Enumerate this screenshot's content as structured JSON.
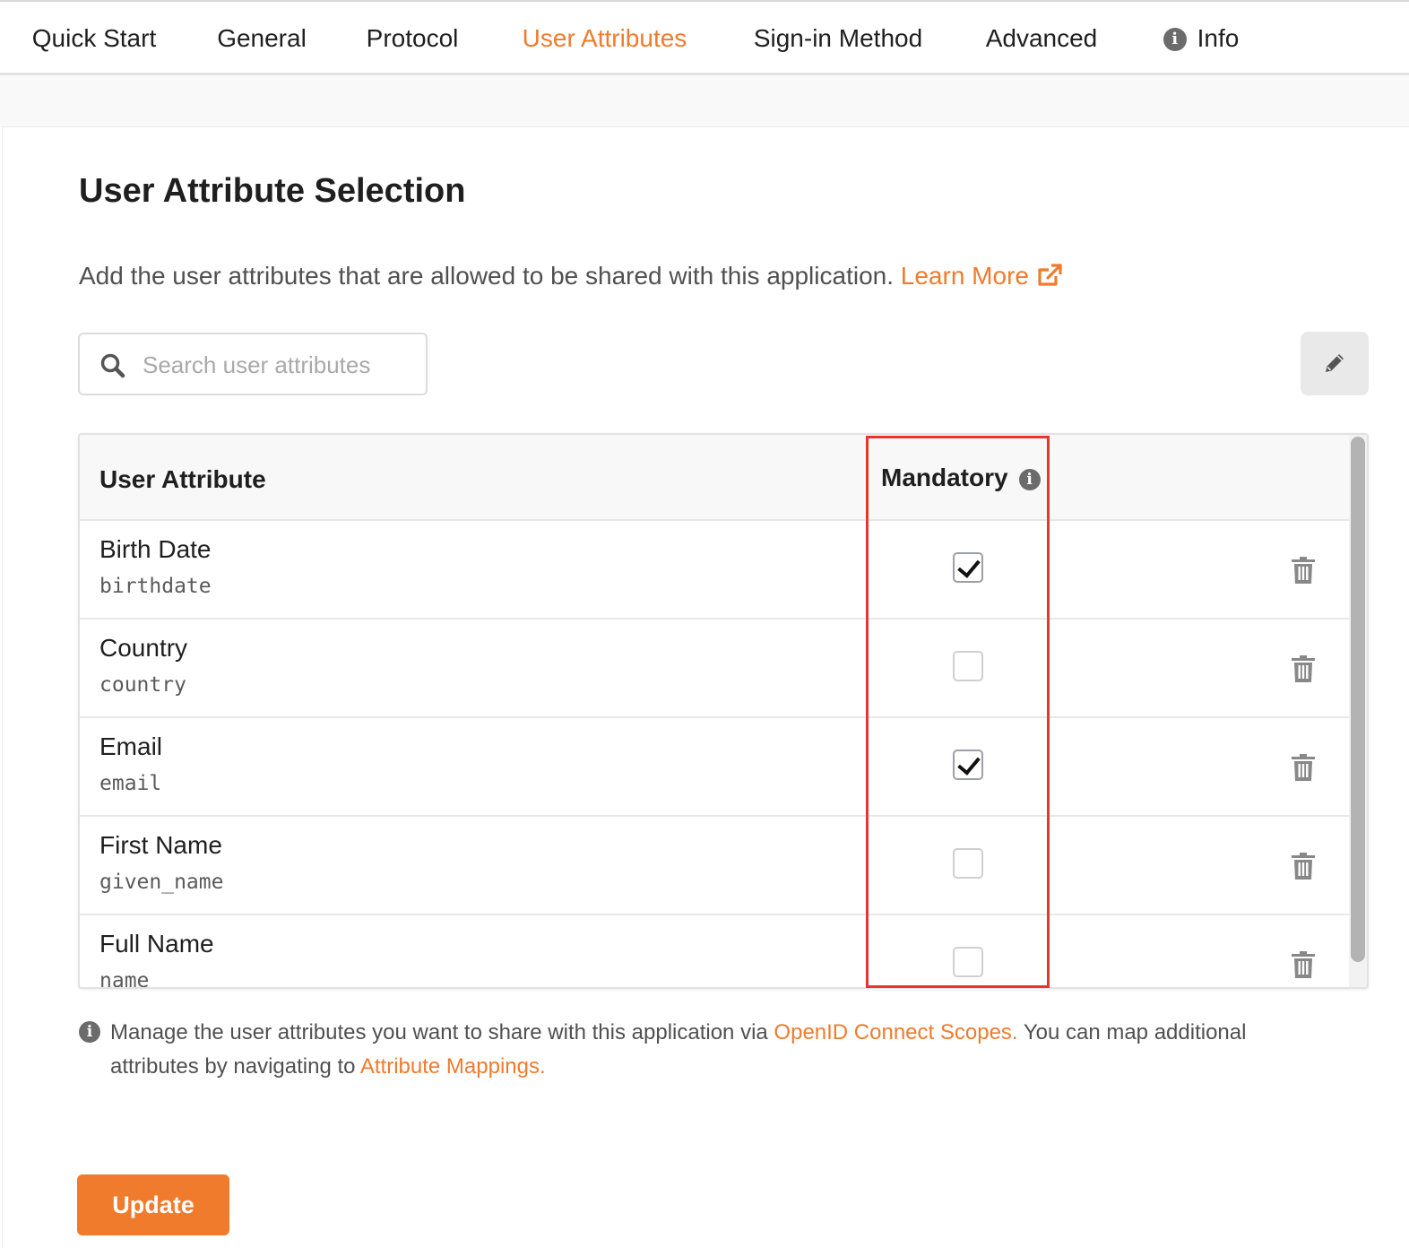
{
  "tabs": [
    {
      "label": "Quick Start",
      "active": false
    },
    {
      "label": "General",
      "active": false
    },
    {
      "label": "Protocol",
      "active": false
    },
    {
      "label": "User Attributes",
      "active": true
    },
    {
      "label": "Sign-in Method",
      "active": false
    },
    {
      "label": "Advanced",
      "active": false
    },
    {
      "label": "Info",
      "active": false,
      "icon": "info-icon"
    }
  ],
  "page": {
    "title": "User Attribute Selection",
    "description": "Add the user attributes that are allowed to be shared with this application.",
    "learn_more": "Learn More"
  },
  "search": {
    "placeholder": "Search user attributes",
    "value": ""
  },
  "table": {
    "headers": {
      "attribute": "User Attribute",
      "mandatory": "Mandatory"
    },
    "rows": [
      {
        "name": "Birth Date",
        "key": "birthdate",
        "mandatory": true
      },
      {
        "name": "Country",
        "key": "country",
        "mandatory": false
      },
      {
        "name": "Email",
        "key": "email",
        "mandatory": true
      },
      {
        "name": "First Name",
        "key": "given_name",
        "mandatory": false
      },
      {
        "name": "Full Name",
        "key": "name",
        "mandatory": false
      }
    ]
  },
  "note": {
    "part1": "Manage the user attributes you want to share with this application via",
    "link1": "OpenID Connect Scopes.",
    "part2": "You can map additional attributes by navigating to",
    "link2": "Attribute Mappings."
  },
  "actions": {
    "update_label": "Update"
  },
  "colors": {
    "accent": "#f07b2d",
    "highlight": "#e5382c",
    "icon_gray": "#6b6b6b"
  }
}
